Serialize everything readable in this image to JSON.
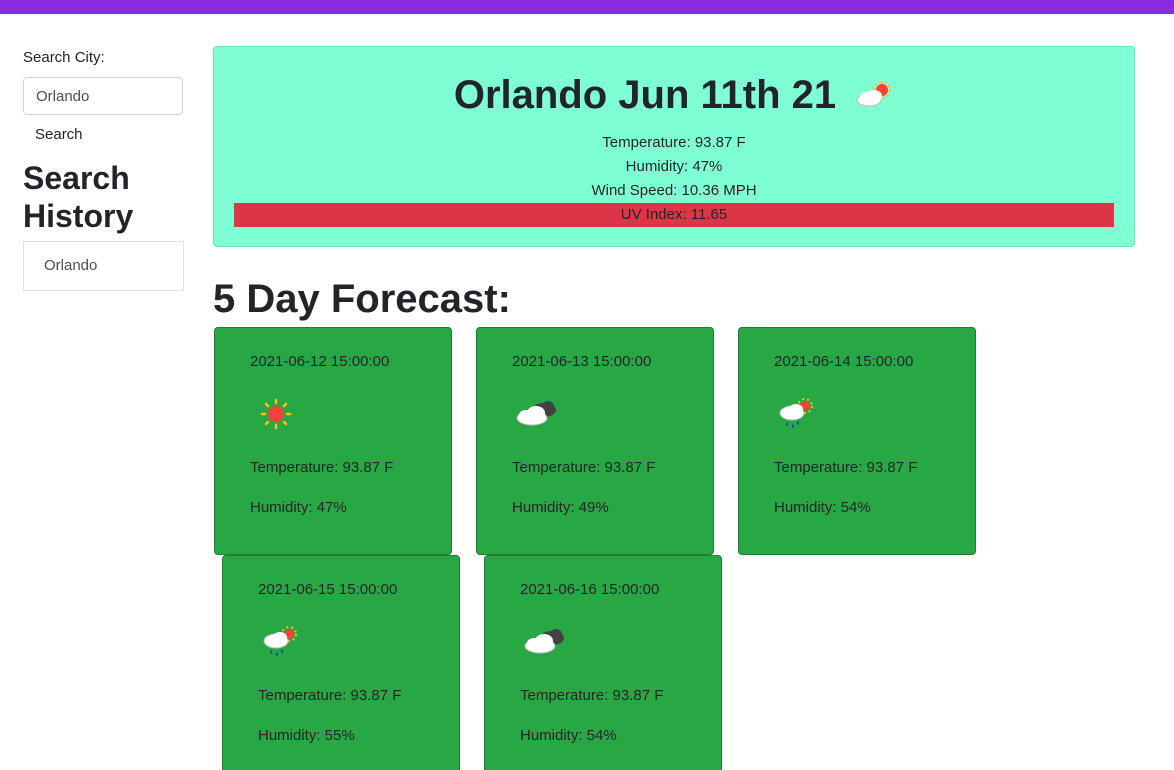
{
  "sidebar": {
    "search_label": "Search City:",
    "search_value": "Orlando",
    "search_button": "Search",
    "history_title": "Search History",
    "history": [
      "Orlando"
    ]
  },
  "current": {
    "title": "Orlando Jun 11th 21",
    "icon": "partly-cloudy-icon",
    "temperature": "Temperature: 93.87 F",
    "humidity": "Humidity: 47%",
    "wind": "Wind Speed: 10.36 MPH",
    "uv": "UV Index: 11.65",
    "uv_color": "#dc3545",
    "bg_color": "#7fffd4"
  },
  "forecast_title": "5 Day Forecast:",
  "forecast": [
    {
      "date": "2021-06-12 15:00:00",
      "icon": "sun-icon",
      "temperature": "Temperature: 93.87 F",
      "humidity": "Humidity: 47%"
    },
    {
      "date": "2021-06-13 15:00:00",
      "icon": "clouds-icon",
      "temperature": "Temperature: 93.87 F",
      "humidity": "Humidity: 49%"
    },
    {
      "date": "2021-06-14 15:00:00",
      "icon": "sun-rain-icon",
      "temperature": "Temperature: 93.87 F",
      "humidity": "Humidity: 54%"
    },
    {
      "date": "2021-06-15 15:00:00",
      "icon": "sun-rain-icon",
      "temperature": "Temperature: 93.87 F",
      "humidity": "Humidity: 55%"
    },
    {
      "date": "2021-06-16 15:00:00",
      "icon": "clouds-icon",
      "temperature": "Temperature: 93.87 F",
      "humidity": "Humidity: 54%"
    }
  ],
  "colors": {
    "topbar": "#8a2be2",
    "card": "#28a745"
  }
}
